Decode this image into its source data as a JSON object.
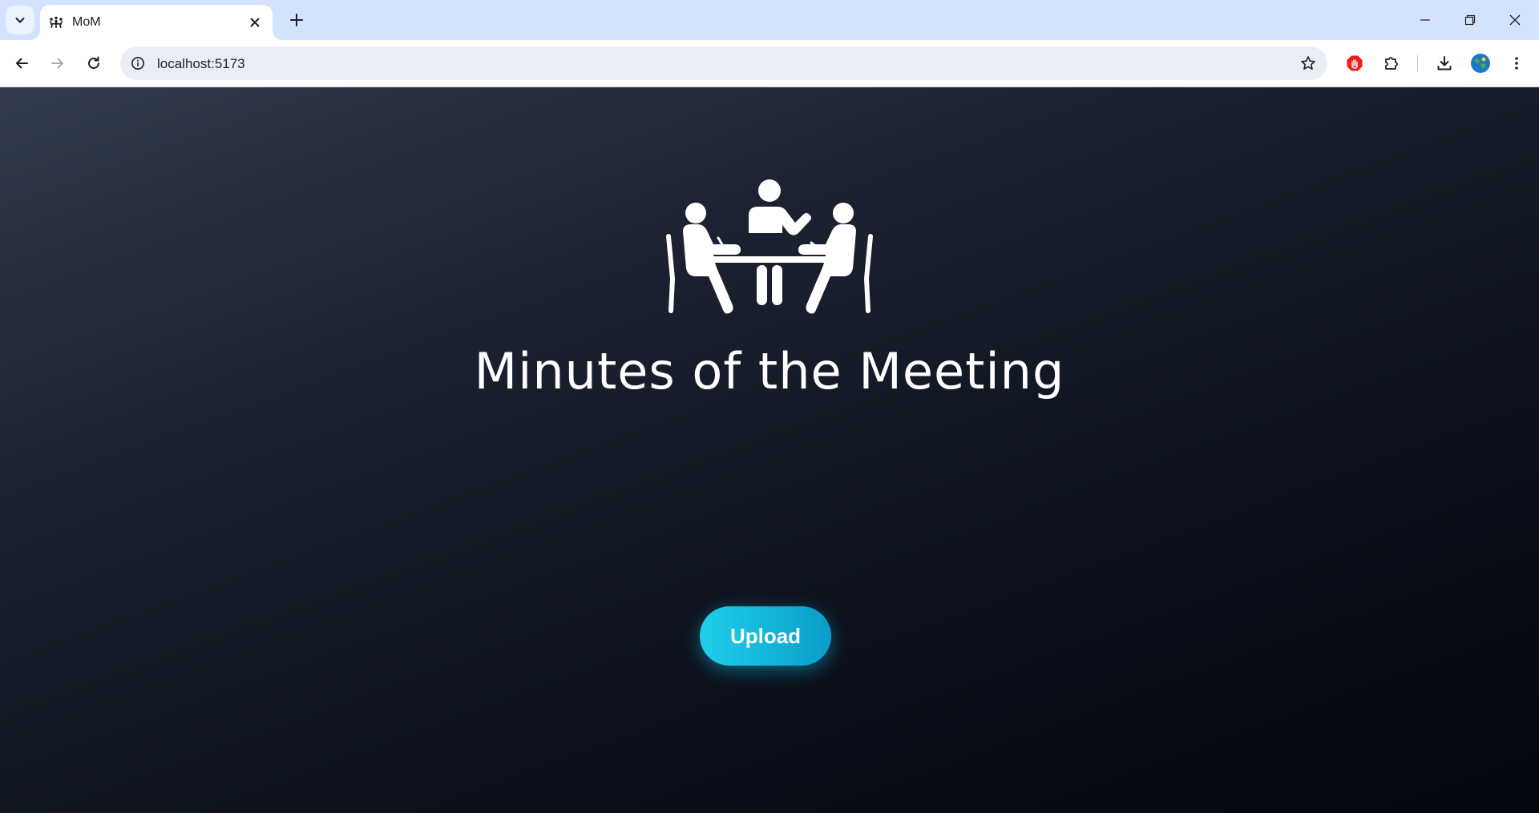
{
  "browser": {
    "tab": {
      "title": "MoM",
      "favicon": "meeting-people-icon"
    },
    "address_bar": {
      "url": "localhost:5173"
    },
    "icons": {
      "tab_search": "chevron-down-icon",
      "tab_close": "close-icon",
      "new_tab": "plus-icon",
      "back": "arrow-left-icon",
      "forward": "arrow-right-icon",
      "reload": "reload-icon",
      "site_info": "info-icon",
      "bookmark": "star-icon",
      "extension_red": "stop-hand-icon",
      "extensions": "puzzle-icon",
      "downloads": "download-icon",
      "profile": "avatar",
      "menu": "more-vertical-icon"
    }
  },
  "page": {
    "hero_icon": "meeting-table-icon",
    "title": "Minutes of the Meeting",
    "upload_label": "Upload"
  },
  "colors": {
    "tabstrip_bg": "#d3e3fd",
    "omnibox_bg": "#e9eef6",
    "page_bg_start": "#333c4d",
    "page_bg_end": "#03060c",
    "button_start": "#1fd0ea",
    "button_end": "#0a9dc8",
    "text_on_dark": "#ffffff"
  }
}
